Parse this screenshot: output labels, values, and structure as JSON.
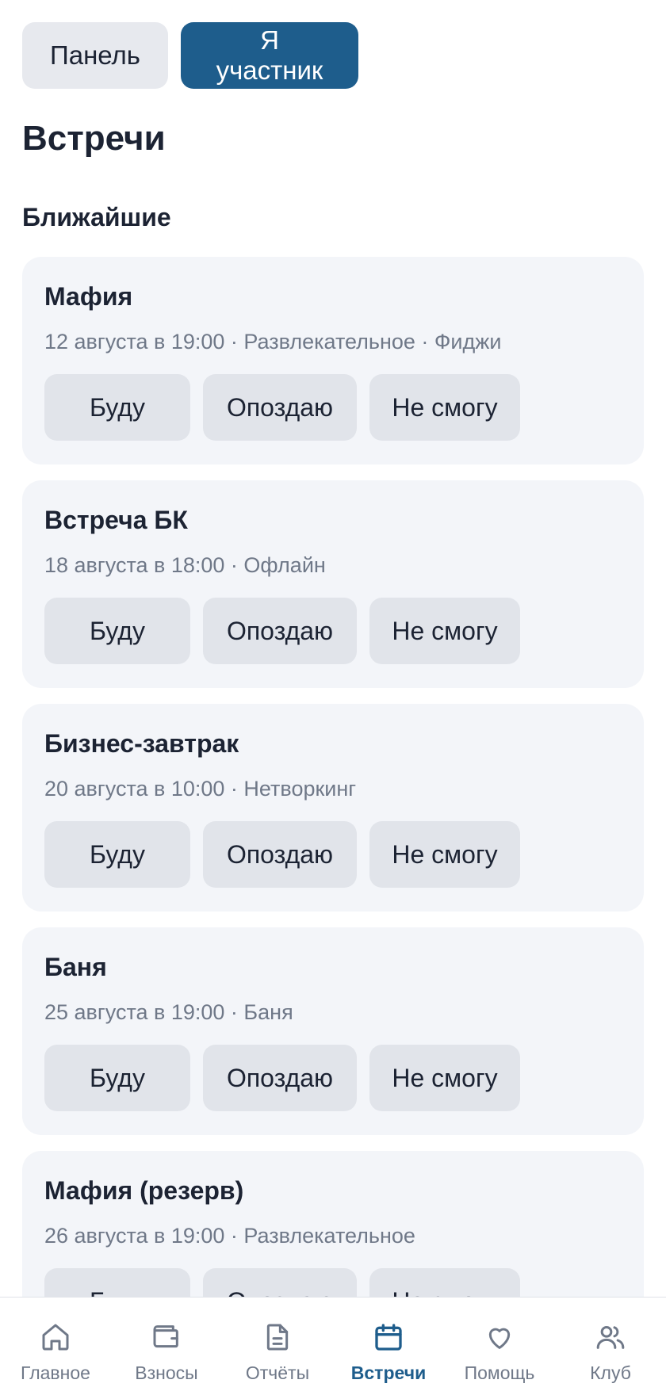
{
  "mode_switch": {
    "panel_label": "Панель",
    "member_label": "Я участник"
  },
  "page_title": "Встречи",
  "section_title": "Ближайшие",
  "events": [
    {
      "title": "Мафия",
      "meta": "12 августа в 19:00 · Развлекательное · Фиджи",
      "actions": [
        "Буду",
        "Опоздаю",
        "Не смогу"
      ]
    },
    {
      "title": "Встреча БК",
      "meta": "18 августа в 18:00 · Офлайн",
      "actions": [
        "Буду",
        "Опоздаю",
        "Не смогу"
      ]
    },
    {
      "title": "Бизнес-завтрак",
      "meta": "20 августа в 10:00 · Нетворкинг",
      "actions": [
        "Буду",
        "Опоздаю",
        "Не смогу"
      ]
    },
    {
      "title": "Баня",
      "meta": "25 августа в 19:00 · Баня",
      "actions": [
        "Буду",
        "Опоздаю",
        "Не смогу"
      ]
    },
    {
      "title": "Мафия (резерв)",
      "meta": "26 августа в 19:00 · Развлекательное",
      "actions": [
        "Буду",
        "Опоздаю",
        "Не смогу"
      ]
    }
  ],
  "tabbar": {
    "items": [
      {
        "label": "Главное",
        "icon": "home-icon",
        "active": false
      },
      {
        "label": "Взносы",
        "icon": "wallet-icon",
        "active": false
      },
      {
        "label": "Отчёты",
        "icon": "document-icon",
        "active": false
      },
      {
        "label": "Встречи",
        "icon": "calendar-icon",
        "active": true
      },
      {
        "label": "Помощь",
        "icon": "heart-icon",
        "active": false
      },
      {
        "label": "Клуб",
        "icon": "users-icon",
        "active": false
      }
    ]
  },
  "colors": {
    "accent": "#1e5d8c",
    "card": "#f3f5f9",
    "button": "#e1e4ea",
    "muted_text": "#6f7888"
  }
}
